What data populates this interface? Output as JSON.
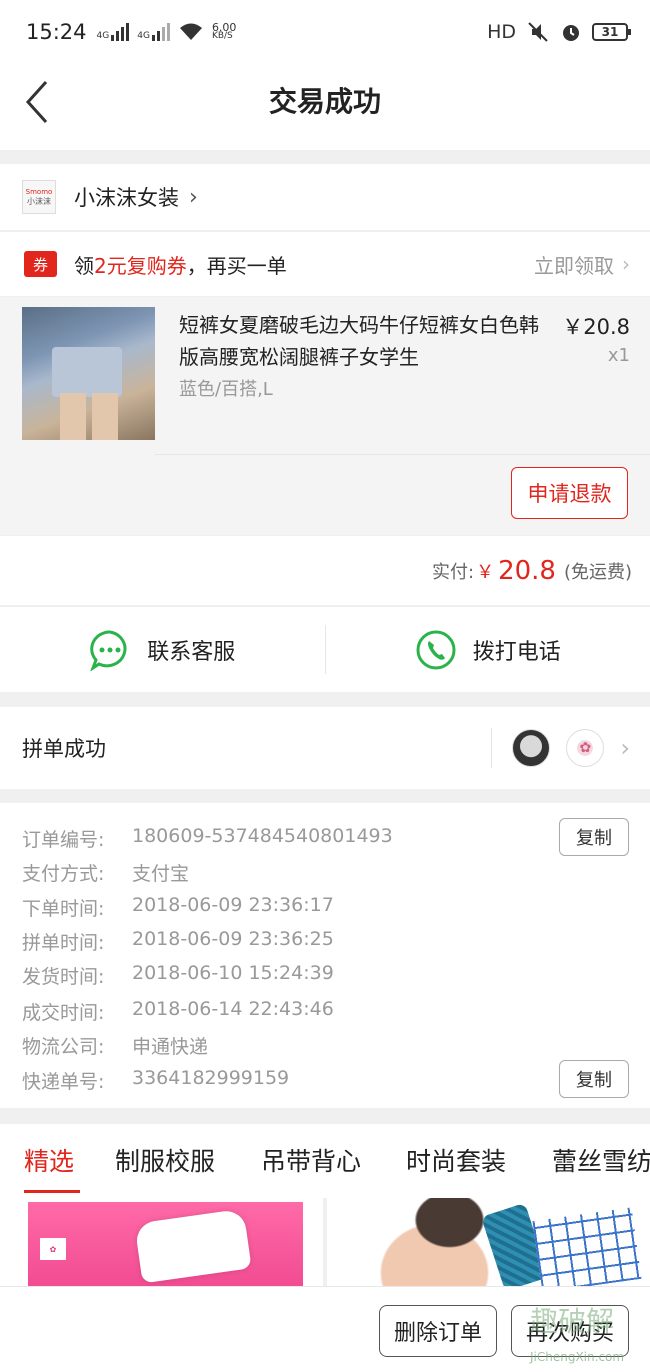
{
  "status_bar": {
    "time": "15:24",
    "net1": "4G",
    "net2": "4G",
    "speed_value": "6.00",
    "speed_unit": "KB/S",
    "hd": "HD",
    "battery": "31"
  },
  "header": {
    "title": "交易成功"
  },
  "shop": {
    "logo_small": "Smomo",
    "logo_big": "小沫沫",
    "name": "小沫沫女装"
  },
  "coupon": {
    "tag": "券",
    "text_pre": "领",
    "text_highlight": "2元复购券",
    "text_post": "，再买一单",
    "action": "立即领取"
  },
  "goods": {
    "title": "短裤女夏磨破毛边大码牛仔短裤女白色韩版高腰宽松阔腿裤子女学生",
    "sku": "蓝色/百搭,L",
    "price": "￥20.8",
    "qty": "x1",
    "refund_label": "申请退款"
  },
  "payment": {
    "label": "实付:",
    "currency": "￥",
    "amount": "20.8",
    "shipping": "(免运费)"
  },
  "contact": {
    "service_label": "联系客服",
    "phone_label": "拨打电话"
  },
  "group": {
    "label": "拼单成功"
  },
  "order_info": {
    "rows": [
      {
        "key": "订单编号:",
        "value": "180609-537484540801493"
      },
      {
        "key": "支付方式:",
        "value": "支付宝"
      },
      {
        "key": "下单时间:",
        "value": "2018-06-09 23:36:17"
      },
      {
        "key": "拼单时间:",
        "value": "2018-06-09 23:36:25"
      },
      {
        "key": "发货时间:",
        "value": "2018-06-10 15:24:39"
      },
      {
        "key": "成交时间:",
        "value": "2018-06-14 22:43:46"
      },
      {
        "key": "物流公司:",
        "value": "申通快递"
      },
      {
        "key": "快递单号:",
        "value": "3364182999159"
      }
    ],
    "copy_label": "复制"
  },
  "tabs": [
    "精选",
    "制服校服",
    "吊带背心",
    "时尚套装",
    "蕾丝雪纺"
  ],
  "bottom_bar": {
    "delete_label": "删除订单",
    "buy_again_label": "再次购买"
  },
  "watermark": {
    "text": "趣破解",
    "url": "JiChengXin.com"
  },
  "colors": {
    "accent": "#e0261d",
    "wechat_green": "#2bb34b"
  }
}
